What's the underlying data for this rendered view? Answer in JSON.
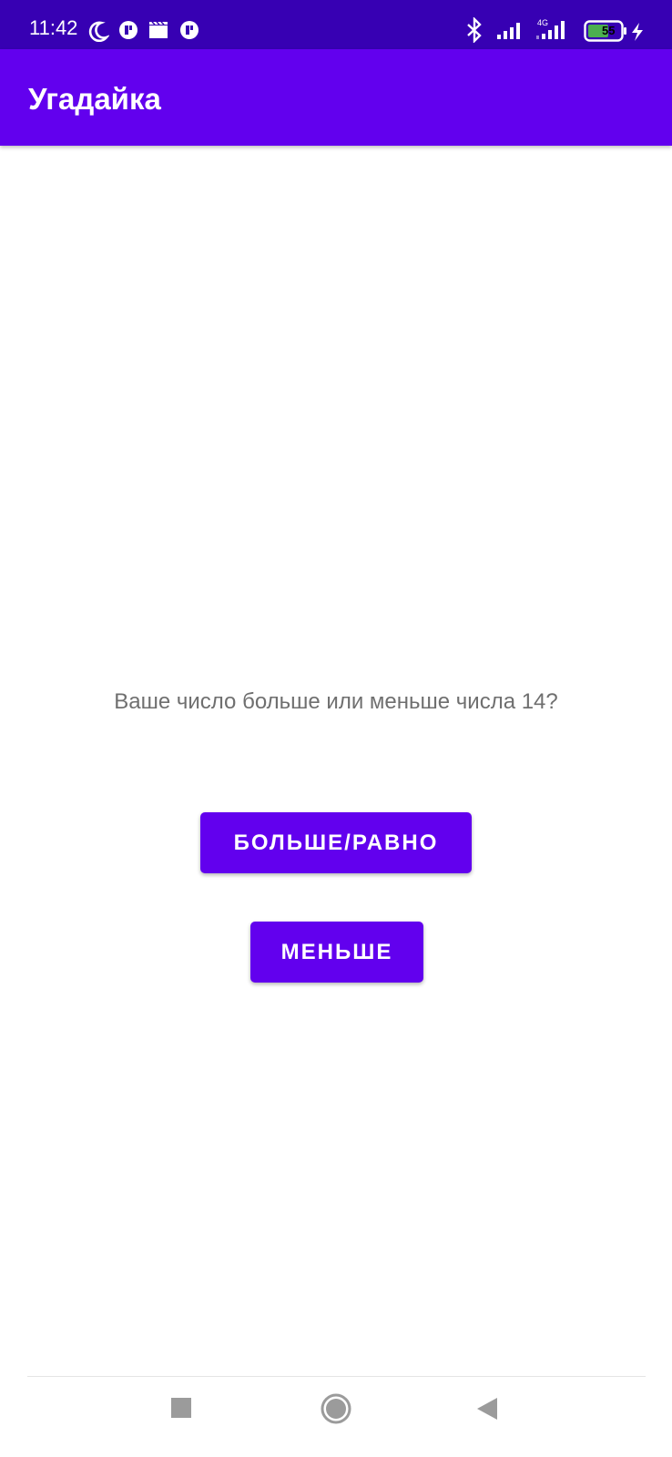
{
  "status_bar": {
    "time": "11:42",
    "battery_level": "55",
    "left_icons": [
      "moon-icon",
      "notification-app-icon",
      "clapper-icon",
      "notification-app-icon"
    ],
    "right_icons": [
      "bluetooth-icon",
      "signal-icon",
      "signal-4g-icon",
      "battery-icon",
      "charging-icon"
    ],
    "background_color": "#3700b3"
  },
  "app_bar": {
    "title": "Угадайка",
    "background_color": "#6200ee"
  },
  "main": {
    "question": "Ваше число больше или меньше числа 14?",
    "buttons": {
      "greater_or_equal": "БОЛЬШЕ/РАВНО",
      "less": "МЕНЬШЕ"
    },
    "button_color": "#6200ee"
  },
  "nav_bar": {
    "buttons": [
      "recents-icon",
      "home-icon",
      "back-icon"
    ]
  }
}
